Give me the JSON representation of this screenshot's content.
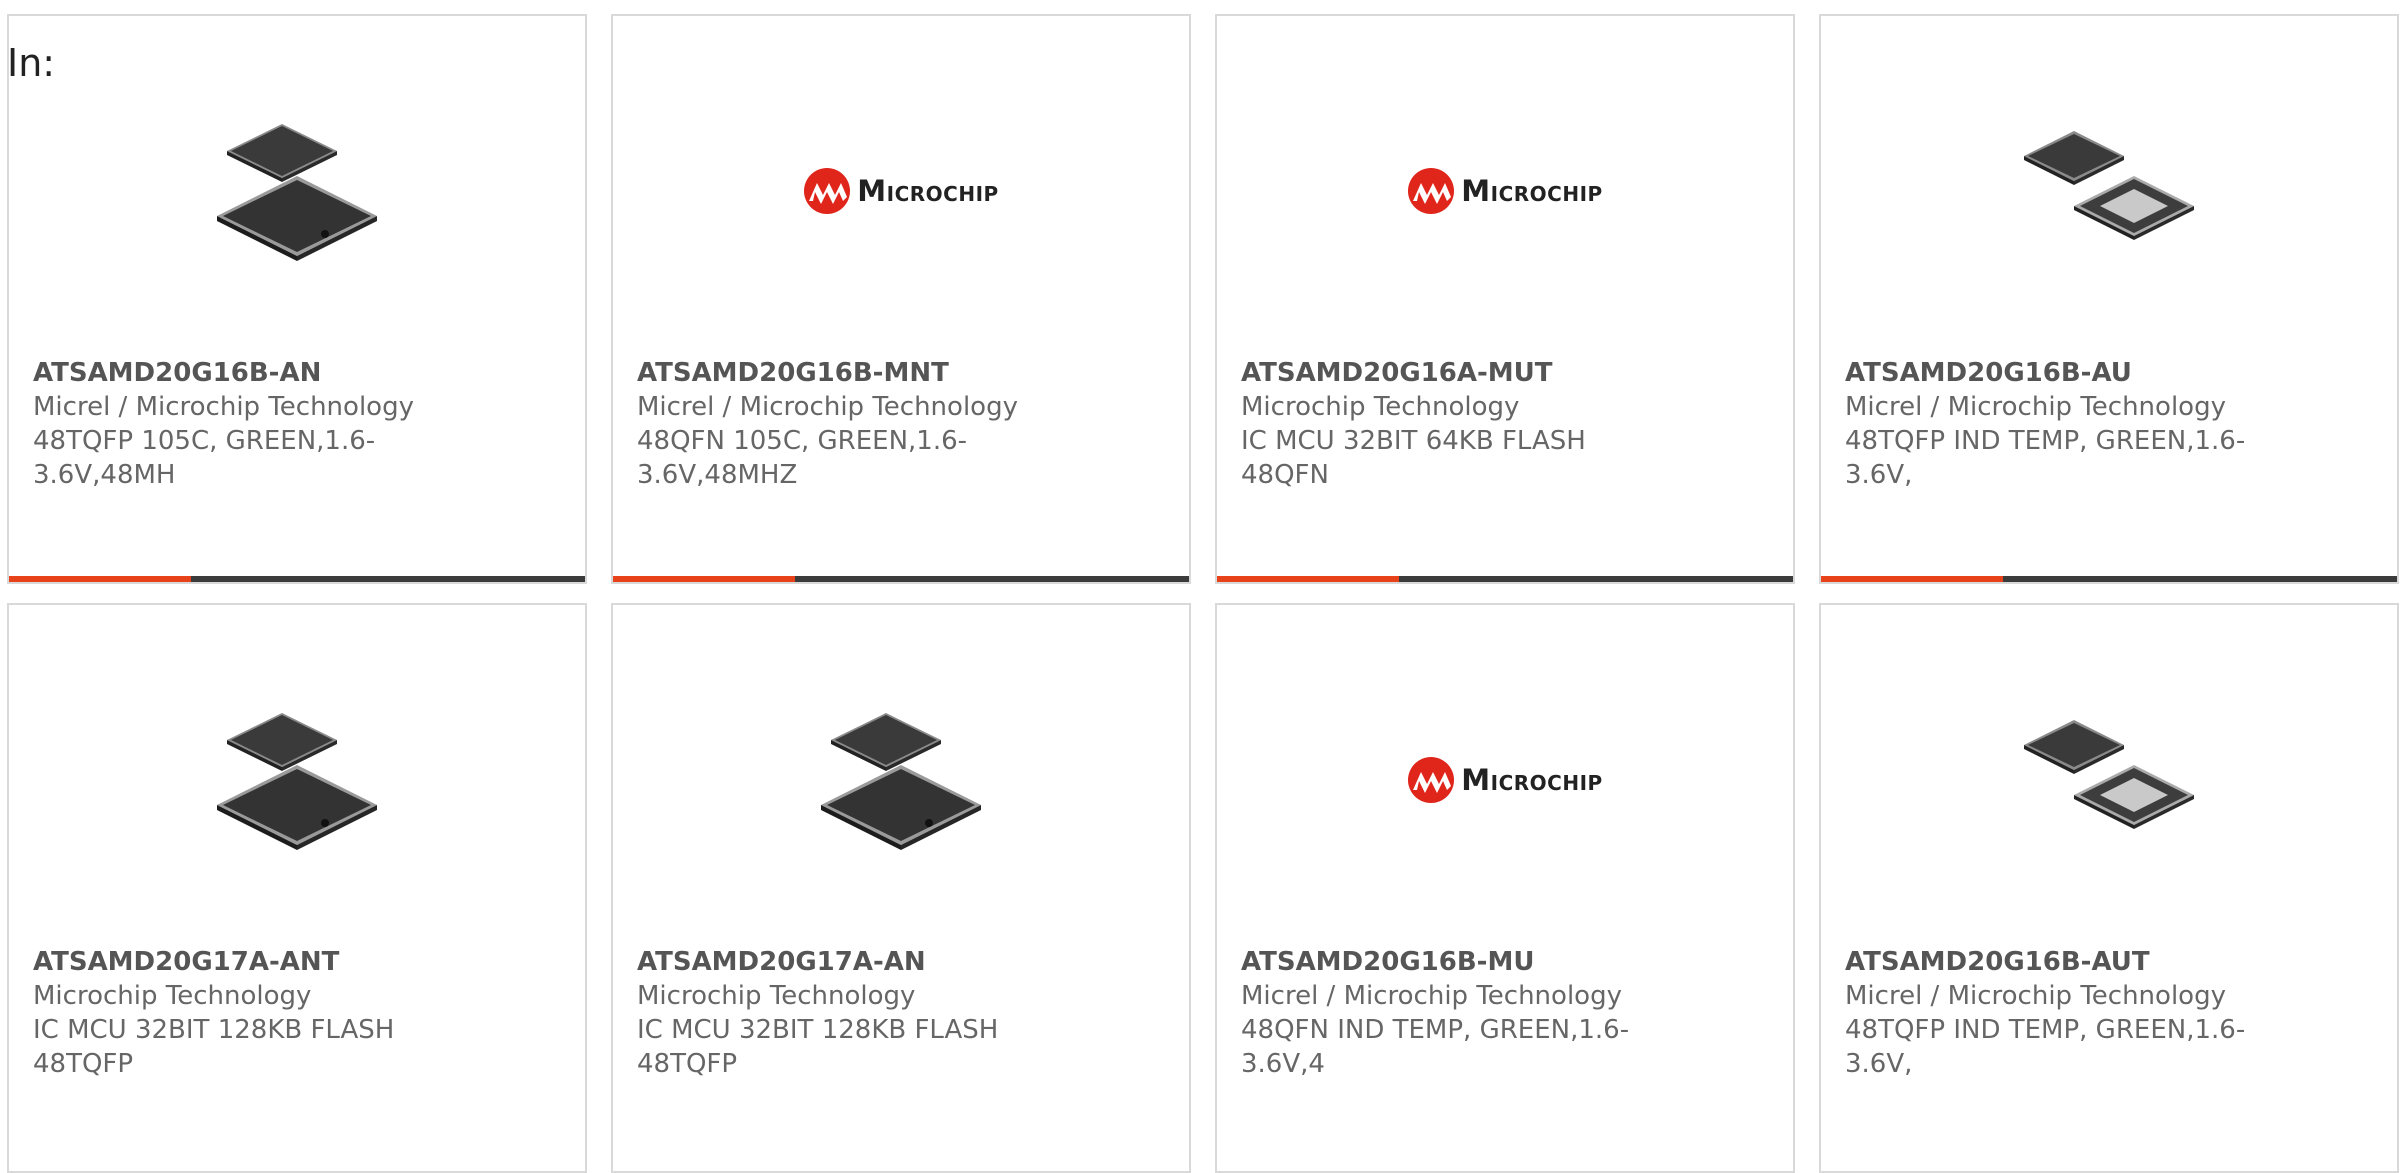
{
  "filter": {
    "label": "In:"
  },
  "colors": {
    "accent": "#e8421b",
    "bar": "#3b3b3b",
    "border": "#d9d9d9",
    "logo_red": "#e0251b"
  },
  "products": [
    {
      "part": "ATSAMD20G16B-AN",
      "maker": "Micrel / Microchip Technology",
      "desc1": "48TQFP 105C, GREEN,1.6-",
      "desc2": "3.6V,48MH",
      "image": "tqfp-chip-image"
    },
    {
      "part": "ATSAMD20G16B-MNT",
      "maker": "Micrel / Microchip Technology",
      "desc1": "48QFN 105C, GREEN,1.6-",
      "desc2": "3.6V,48MHZ",
      "image": "microchip-logo",
      "logo_text": "Microchip"
    },
    {
      "part": "ATSAMD20G16A-MUT",
      "maker": "Microchip Technology",
      "desc1": "IC MCU 32BIT 64KB FLASH",
      "desc2": "48QFN",
      "image": "microchip-logo",
      "logo_text": "Microchip"
    },
    {
      "part": "ATSAMD20G16B-AU",
      "maker": "Micrel / Microchip Technology",
      "desc1": "48TQFP IND TEMP, GREEN,1.6-",
      "desc2": "3.6V,",
      "image": "tqfp-chip-bottom-image"
    },
    {
      "part": "ATSAMD20G17A-ANT",
      "maker": "Microchip Technology",
      "desc1": "IC MCU 32BIT 128KB FLASH",
      "desc2": "48TQFP",
      "image": "tqfp-chip-image"
    },
    {
      "part": "ATSAMD20G17A-AN",
      "maker": "Microchip Technology",
      "desc1": "IC MCU 32BIT 128KB FLASH",
      "desc2": "48TQFP",
      "image": "tqfp-chip-image"
    },
    {
      "part": "ATSAMD20G16B-MU",
      "maker": "Micrel / Microchip Technology",
      "desc1": "48QFN IND TEMP, GREEN,1.6-",
      "desc2": "3.6V,4",
      "image": "microchip-logo",
      "logo_text": "Microchip"
    },
    {
      "part": "ATSAMD20G16B-AUT",
      "maker": "Micrel / Microchip Technology",
      "desc1": "48TQFP IND TEMP, GREEN,1.6-",
      "desc2": "3.6V,",
      "image": "tqfp-chip-bottom-image"
    }
  ]
}
